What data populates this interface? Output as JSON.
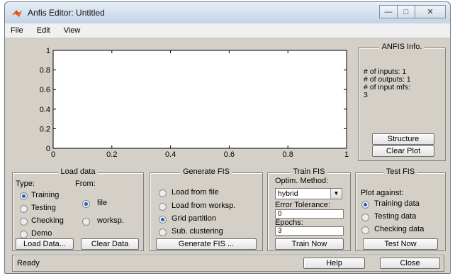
{
  "window": {
    "title": "Anfis Editor: Untitled"
  },
  "menu": {
    "items": [
      "File",
      "Edit",
      "View"
    ]
  },
  "chart_data": {
    "type": "line",
    "title": "",
    "xlabel": "",
    "ylabel": "",
    "xlim": [
      0,
      1
    ],
    "ylim": [
      0,
      1
    ],
    "x_ticks": [
      "0",
      "0.2",
      "0.4",
      "0.6",
      "0.8",
      "1"
    ],
    "y_ticks": [
      "0",
      "0.2",
      "0.4",
      "0.6",
      "0.8",
      "1"
    ],
    "series": [],
    "grid": false
  },
  "anfis_info": {
    "title": "ANFIS Info.",
    "lines": [
      "# of inputs: 1",
      "# of outputs: 1",
      "# of input mfs:",
      "3"
    ],
    "structure_label": "Structure",
    "clear_plot_label": "Clear Plot"
  },
  "load_data": {
    "title": "Load data",
    "type_label": "Type:",
    "from_label": "From:",
    "types": [
      "Training",
      "Testing",
      "Checking",
      "Demo"
    ],
    "selected_type": "Training",
    "sources": [
      "file",
      "worksp."
    ],
    "selected_source": "file",
    "load_button": "Load Data...",
    "clear_button": "Clear Data"
  },
  "generate_fis": {
    "title": "Generate FIS",
    "options": [
      "Load from file",
      "Load from worksp.",
      "Grid partition",
      "Sub. clustering"
    ],
    "selected": "Grid partition",
    "button": "Generate FIS ..."
  },
  "train_fis": {
    "title": "Train FIS",
    "method_label": "Optim. Method:",
    "method_value": "hybrid",
    "error_label": "Error Tolerance:",
    "error_value": "0",
    "epochs_label": "Epochs:",
    "epochs_value": "3",
    "button": "Train Now"
  },
  "test_fis": {
    "title": "Test FIS",
    "plot_label": "Plot against:",
    "options": [
      "Training data",
      "Testing data",
      "Checking data"
    ],
    "selected": "Training data",
    "button": "Test Now"
  },
  "status": {
    "text": "Ready",
    "help_label": "Help",
    "close_label": "Close"
  },
  "colors": {
    "accent": "#1f5fd6",
    "panel": "#d4d0c8"
  }
}
